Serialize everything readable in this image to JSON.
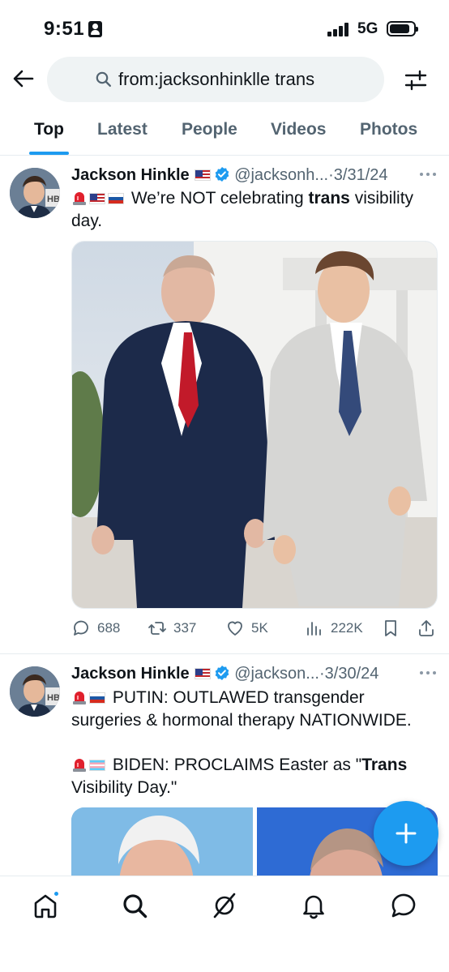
{
  "status_bar": {
    "time": "9:51",
    "network": "5G"
  },
  "search": {
    "query": "from:jacksonhinklle trans"
  },
  "tabs": [
    {
      "label": "Top",
      "active": true
    },
    {
      "label": "Latest",
      "active": false
    },
    {
      "label": "People",
      "active": false
    },
    {
      "label": "Videos",
      "active": false
    },
    {
      "label": "Photos",
      "active": false
    }
  ],
  "tweets": [
    {
      "name": "Jackson Hinkle",
      "handle": "@jacksonh...",
      "separator": "·",
      "date": "3/31/24",
      "text_parts": {
        "before": "We’re NOT celebrating ",
        "bold": "trans",
        "after": " visibility day."
      },
      "replies": "688",
      "reposts": "337",
      "likes": "5K",
      "views": "222K"
    },
    {
      "name": "Jackson Hinkle",
      "handle": "@jackson...",
      "separator": "·",
      "date": "3/30/24",
      "line1": "PUTIN: OUTLAWED transgender surgeries & hormonal therapy NATIONWIDE.",
      "line2_before": "BIDEN: PROCLAIMS Easter as \"",
      "line2_bold": "Trans",
      "line2_after": " Visibility Day.\""
    }
  ],
  "colors": {
    "accent": "#1d9bf0",
    "text": "#0f1419",
    "secondary": "#536471"
  },
  "icons": {
    "back": "arrow-left-icon",
    "search": "search-icon",
    "filter": "sliders-icon",
    "compose": "plus-icon",
    "nav": [
      "home-icon",
      "search-icon",
      "grok-icon",
      "bell-icon",
      "messages-icon"
    ]
  }
}
